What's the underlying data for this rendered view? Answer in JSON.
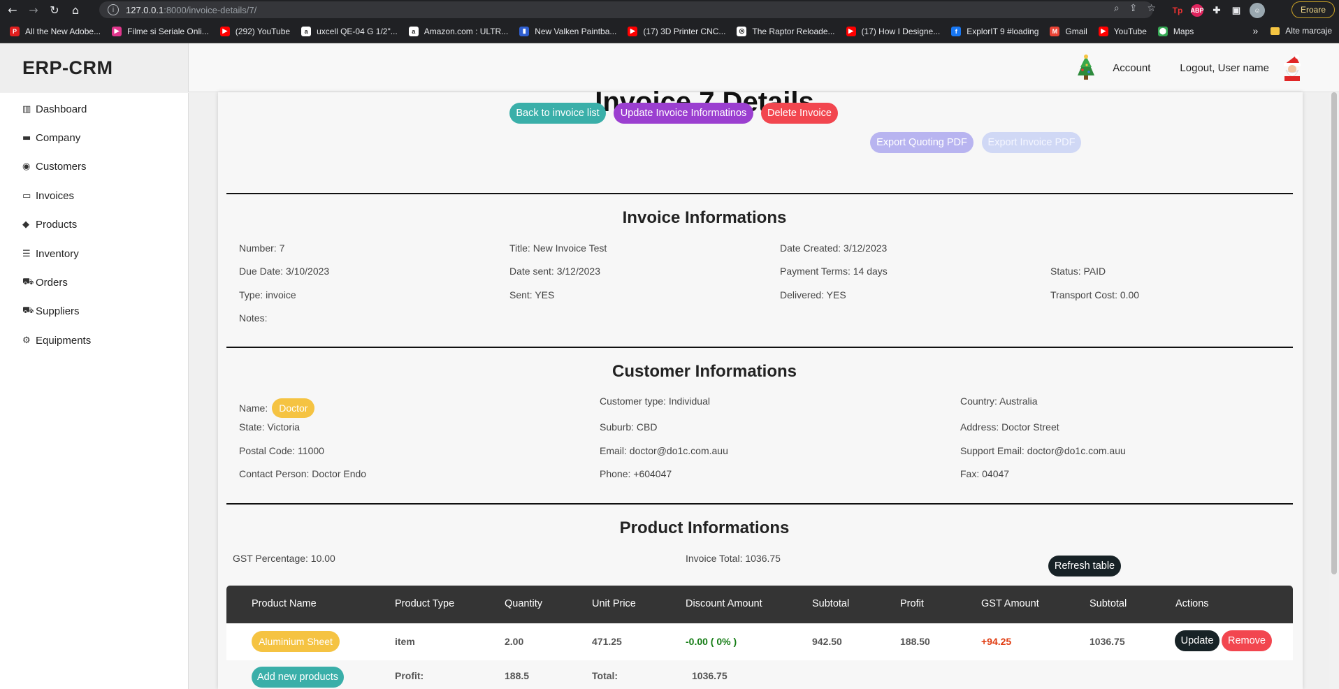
{
  "browser": {
    "url_host": "127.0.0.1",
    "url_path": ":8000/invoice-details/7/",
    "profile_button": "Eroare",
    "bookmarks": [
      {
        "label": "All the New Adobe...",
        "color": "#e01e1e",
        "icon": "P"
      },
      {
        "label": "Filme si Seriale Onli...",
        "color": "#e0368c",
        "icon": "▶"
      },
      {
        "label": "(292) YouTube",
        "color": "#ff0000",
        "icon": "▶"
      },
      {
        "label": "uxcell QE-04 G 1/2\"...",
        "color": "#ffffff",
        "icon": "a"
      },
      {
        "label": "Amazon.com : ULTR...",
        "color": "#ffffff",
        "icon": "a"
      },
      {
        "label": "New Valken Paintba...",
        "color": "#2f5fd0",
        "icon": "▮"
      },
      {
        "label": "(17) 3D Printer CNC...",
        "color": "#ff0000",
        "icon": "▶"
      },
      {
        "label": "The Raptor Reloade...",
        "color": "#ffffff",
        "icon": "◎"
      },
      {
        "label": "(17) How I Designe...",
        "color": "#ff0000",
        "icon": "▶"
      },
      {
        "label": "ExplorIT 9 #loading",
        "color": "#1877f2",
        "icon": "f"
      },
      {
        "label": "Gmail",
        "color": "#ea4335",
        "icon": "M"
      },
      {
        "label": "YouTube",
        "color": "#ff0000",
        "icon": "▶"
      },
      {
        "label": "Maps",
        "color": "#34a853",
        "icon": "⬤"
      }
    ],
    "other_bookmarks": "Alte marcaje"
  },
  "header": {
    "brand": "ERP-CRM",
    "account": "Account",
    "logout": "Logout, User name"
  },
  "sidebar": {
    "items": [
      {
        "label": "Dashboard",
        "icon": "chart-bar-icon",
        "glyph": "▥"
      },
      {
        "label": "Company",
        "icon": "folder-icon",
        "glyph": "▬"
      },
      {
        "label": "Customers",
        "icon": "user-circle-icon",
        "glyph": "◉"
      },
      {
        "label": "Invoices",
        "icon": "folder-open-icon",
        "glyph": "▭"
      },
      {
        "label": "Products",
        "icon": "tags-icon",
        "glyph": "◆"
      },
      {
        "label": "Inventory",
        "icon": "database-icon",
        "glyph": "☰"
      },
      {
        "label": "Orders",
        "icon": "cart-icon",
        "glyph": "⛟"
      },
      {
        "label": "Suppliers",
        "icon": "truck-icon",
        "glyph": "⛟"
      },
      {
        "label": "Equipments",
        "icon": "gears-icon",
        "glyph": "⚙"
      }
    ]
  },
  "page": {
    "title": "Invoice 7 Details",
    "buttons": {
      "back": "Back to invoice list",
      "update": "Update Invoice Informatinos",
      "delete": "Delete Invoice",
      "export_quote": "Export Quoting PDF",
      "export_invoice": "Export Invoice PDF"
    }
  },
  "invoice": {
    "section_title": "Invoice Informations",
    "number": "Number: 7",
    "title": "Title: New Invoice Test",
    "date_created": "Date Created: 3/12/2023",
    "due_date": "Due Date: 3/10/2023",
    "date_sent": "Date sent: 3/12/2023",
    "payment_terms": "Payment Terms: 14 days",
    "status": "Status: PAID",
    "type": "Type: invoice",
    "sent": "Sent: YES",
    "delivered": "Delivered: YES",
    "transport_cost": "Transport Cost: 0.00",
    "notes": "Notes:"
  },
  "customer": {
    "section_title": "Customer Informations",
    "name_label": "Name:",
    "name_value": "Doctor",
    "customer_type": "Customer type: Individual",
    "country": "Country: Australia",
    "state": "State: Victoria",
    "suburb": "Suburb: CBD",
    "address": "Address: Doctor Street",
    "postal_code": "Postal Code: 11000",
    "email": "Email: doctor@do1c.com.auu",
    "support_email": "Support Email: doctor@do1c.com.auu",
    "contact_person": "Contact Person: Doctor Endo",
    "phone": "Phone: +604047",
    "fax": "Fax: 04047"
  },
  "products": {
    "section_title": "Product Informations",
    "gst_percentage": "GST Percentage: 10.00",
    "invoice_total": "Invoice Total: 1036.75",
    "refresh": "Refresh table",
    "columns": [
      "Product Name",
      "Product Type",
      "Quantity",
      "Unit Price",
      "Discount Amount",
      "Subtotal",
      "Profit",
      "GST Amount",
      "Subtotal",
      "Actions"
    ],
    "rows": [
      {
        "name": "Aluminium Sheet",
        "type": "item",
        "quantity": "2.00",
        "unit_price": "471.25",
        "discount": "-0.00 ( 0% )",
        "subtotal": "942.50",
        "profit": "188.50",
        "gst": "+94.25",
        "subtotal_gst": "1036.75",
        "update": "Update",
        "remove": "Remove"
      }
    ],
    "footer": {
      "add": "Add new products",
      "profit_label": "Profit:",
      "profit_value": "188.5",
      "total_label": "Total:",
      "total_value": "1036.75"
    }
  }
}
